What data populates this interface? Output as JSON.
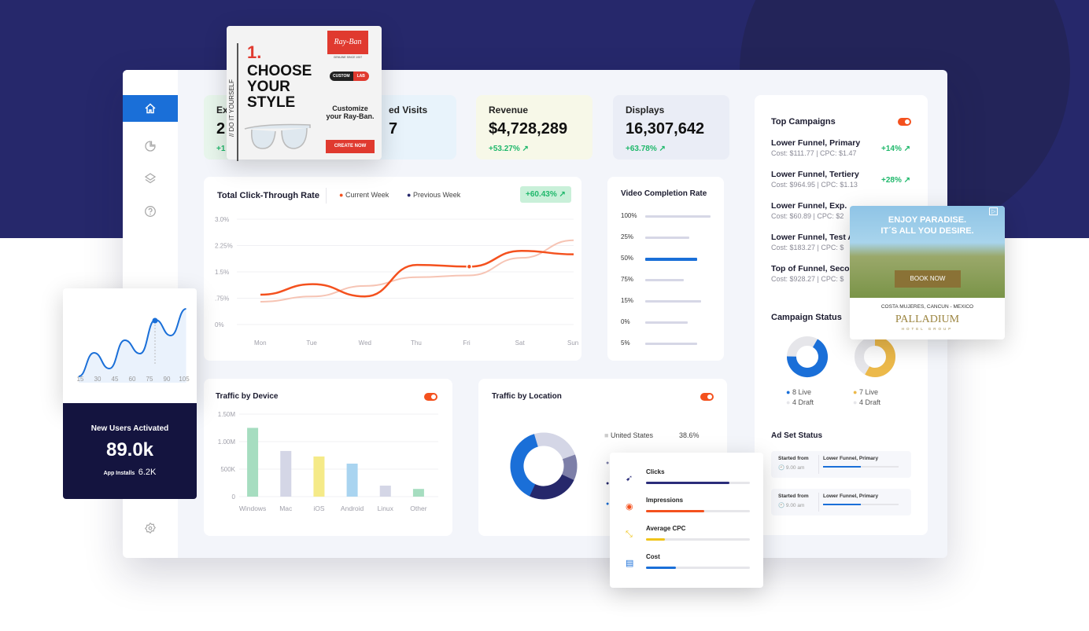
{
  "colors": {
    "accent": "#1a6fd8",
    "orange": "#f4511e",
    "green": "#1fb86b",
    "navy": "#26286b",
    "dark_card": "#14143f"
  },
  "sidebar": {
    "items": [
      {
        "icon": "home-icon",
        "active": true
      },
      {
        "icon": "pie-chart-icon"
      },
      {
        "icon": "layers-icon"
      },
      {
        "icon": "help-icon"
      },
      {
        "icon": "settings-icon"
      }
    ]
  },
  "kpis": [
    {
      "label": "Ex",
      "value": "2",
      "change": "+1"
    },
    {
      "label": "ed Visits",
      "value": "7",
      "change": ""
    },
    {
      "label": "Revenue",
      "value": "$4,728,289",
      "change": "+53.27%"
    },
    {
      "label": "Displays",
      "value": "16,307,642",
      "change": "+63.78%"
    }
  ],
  "ctr": {
    "title": "Total Click-Through Rate",
    "legend_current": "Current Week",
    "legend_previous": "Previous Week",
    "badge": "+60.43%"
  },
  "chart_data": [
    {
      "type": "line",
      "title": "Total Click-Through Rate",
      "categories": [
        "Mon",
        "Tue",
        "Wed",
        "Thu",
        "Fri",
        "Sat",
        "Sun"
      ],
      "yticks": [
        "3.0%",
        "2.25%",
        "1.5%",
        ".75%",
        "0%"
      ],
      "ylim": [
        0,
        3.0
      ],
      "series": [
        {
          "name": "Current Week",
          "values": [
            0.85,
            1.15,
            0.8,
            1.7,
            1.65,
            2.1,
            2.0
          ]
        },
        {
          "name": "Previous Week",
          "values": [
            0.65,
            0.8,
            1.1,
            1.35,
            1.4,
            1.9,
            2.4
          ]
        }
      ]
    },
    {
      "type": "bar",
      "title": "Video Completion Rate",
      "categories": [
        "100%",
        "25%",
        "50%",
        "75%",
        "15%",
        "0%",
        "5%"
      ],
      "values": [
        100,
        67,
        80,
        59,
        86,
        65,
        80
      ],
      "highlight": "50%"
    },
    {
      "type": "bar",
      "title": "Traffic by Device",
      "categories": [
        "Windows",
        "Mac",
        "iOS",
        "Android",
        "Linux",
        "Other"
      ],
      "values": [
        1250000,
        830000,
        730000,
        600000,
        200000,
        140000
      ],
      "yticks": [
        "1.50M",
        "1.00M",
        "500K",
        "0"
      ],
      "ylim": [
        0,
        1500000
      ]
    },
    {
      "type": "pie",
      "title": "Traffic by Location",
      "labels": [
        "United States"
      ],
      "values": [
        38.6
      ],
      "display": [
        "38.6%"
      ]
    },
    {
      "type": "line",
      "title": "New Users",
      "x": [
        15,
        30,
        45,
        60,
        75,
        90,
        105
      ]
    }
  ],
  "vcr": {
    "title": "Video Completion Rate"
  },
  "device": {
    "title": "Traffic by Device"
  },
  "location": {
    "title": "Traffic by Location",
    "row_label": "United States",
    "row_value": "38.6%"
  },
  "campaigns": {
    "title": "Top Campaigns",
    "items": [
      {
        "name": "Lower Funnel, Primary",
        "sub": "Cost: $111.77  |  CPC: $1.47",
        "change": "+14%"
      },
      {
        "name": "Lower Funnel, Tertiery",
        "sub": "Cost: $964.95  |  CPC: $1.13",
        "change": "+28%"
      },
      {
        "name": "Lower Funnel, Exp.",
        "sub": "Cost: $60.89  |  CPC: $2",
        "change": ""
      },
      {
        "name": "Lower Funnel, Test A",
        "sub": "Cost: $183.27  |  CPC: $",
        "change": ""
      },
      {
        "name": "Top of Funnel, Secor",
        "sub": "Cost: $928.27  |  CPC: $",
        "change": ""
      }
    ]
  },
  "campaign_status": {
    "title": "Campaign Status",
    "a_live": "8 Live",
    "a_draft": "4 Draft",
    "b_live": "7 Live",
    "b_draft": "4 Draft"
  },
  "adset": {
    "title": "Ad Set Status",
    "rows": [
      {
        "started": "Started from",
        "time": "9.00 am",
        "name": "Lower Funnel, Primary",
        "progress": 0.5
      },
      {
        "started": "Started from",
        "time": "9.00 am",
        "name": "Lower Funnel, Primary",
        "progress": 0.5
      }
    ]
  },
  "users": {
    "x": [
      "15",
      "30",
      "45",
      "60",
      "75",
      "90",
      "105"
    ],
    "title": "New Users Activated",
    "value": "89.0k",
    "installs_label": "App Installs",
    "installs_value": "6.2K"
  },
  "metrics": [
    {
      "label": "Clicks",
      "progress": 0.8,
      "color": "#2b2d7a"
    },
    {
      "label": "Impressions",
      "progress": 0.56,
      "color": "#f4511e"
    },
    {
      "label": "Average CPC",
      "progress": 0.18,
      "color": "#f0c419"
    },
    {
      "label": "Cost",
      "progress": 0.29,
      "color": "#1a6fd8"
    }
  ],
  "rayban_ad": {
    "step": "1.",
    "headline": "CHOOSE YOUR STYLE",
    "side": "// DO IT YOURSELF",
    "brand": "Ray-Ban",
    "tag": "GENUINE SINCE 1937",
    "custom": "CUSTOM",
    "lab": "LAB",
    "copy": "Customize your Ray-Ban.",
    "cta": "CREATE NOW"
  },
  "palladium_ad": {
    "headline1": "ENJOY PARADISE.",
    "headline2": "IT´S ALL YOU DESIRE.",
    "cta": "BOOK NOW",
    "location": "COSTA MUJERES, CANCUN - MEXICO",
    "brand": "PALLADIUM",
    "sub": "HOTEL GROUP"
  }
}
